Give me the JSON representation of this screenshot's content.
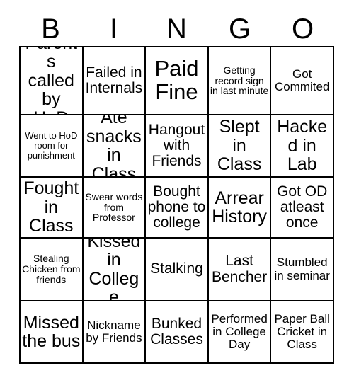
{
  "card": {
    "title": "BINGO",
    "header_letters": [
      "B",
      "I",
      "N",
      "G",
      "O"
    ],
    "grid": {
      "columns": 5,
      "rows": 5,
      "border_color": "#000000",
      "background_color": "#ffffff",
      "text_color": "#000000"
    },
    "cells": [
      [
        {
          "text": "Parents called by HoD",
          "size": "lg"
        },
        {
          "text": "Failed in Internals",
          "size": "md"
        },
        {
          "text": "Paid Fine",
          "size": "xl"
        },
        {
          "text": "Getting record sign in last minute",
          "size": "xs"
        },
        {
          "text": "Got Commited",
          "size": "sm"
        }
      ],
      [
        {
          "text": "Went to HoD room for punishment",
          "size": "xxs"
        },
        {
          "text": "Ate snacks in Class",
          "size": "lg"
        },
        {
          "text": "Hangout with Friends",
          "size": "md"
        },
        {
          "text": "Slept in Class",
          "size": "lg"
        },
        {
          "text": "Hacked in Lab",
          "size": "lg"
        }
      ],
      [
        {
          "text": "Fought in Class",
          "size": "lg"
        },
        {
          "text": "Swear words from Professor",
          "size": "xs"
        },
        {
          "text": "Bought phone to college",
          "size": "md"
        },
        {
          "text": "Arrear History",
          "size": "lg"
        },
        {
          "text": "Got OD atleast once",
          "size": "md"
        }
      ],
      [
        {
          "text": "Stealing Chicken from friends",
          "size": "xs"
        },
        {
          "text": "Kissed in College",
          "size": "lg"
        },
        {
          "text": "Stalking",
          "size": "md"
        },
        {
          "text": "Last Bencher",
          "size": "md"
        },
        {
          "text": "Stumbled in seminar",
          "size": "sm"
        }
      ],
      [
        {
          "text": "Missed the bus",
          "size": "lg"
        },
        {
          "text": "Nickname by Friends",
          "size": "sm"
        },
        {
          "text": "Bunked Classes",
          "size": "md"
        },
        {
          "text": "Performed in College Day",
          "size": "sm"
        },
        {
          "text": "Paper Ball Cricket in Class",
          "size": "sm"
        }
      ]
    ]
  }
}
